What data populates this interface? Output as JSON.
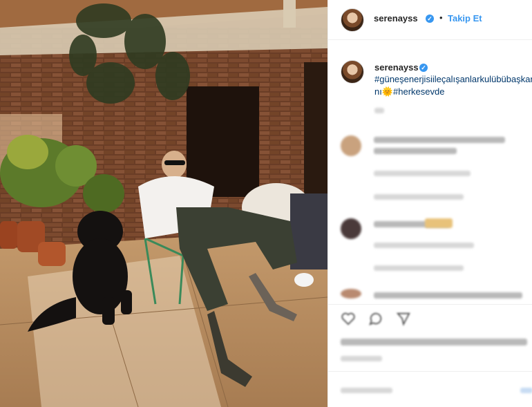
{
  "header": {
    "username": "serenayss",
    "verified_glyph": "✓",
    "separator": "•",
    "follow_label": "Takip Et"
  },
  "caption": {
    "username": "serenayss",
    "line1": "#güneşenerjisiileçalışanlarkulübübaşkanı",
    "line2_prefix": "nı",
    "emoji": "🌞",
    "line2_tag": "#herkesevde"
  },
  "icons": {
    "avatar": "avatar-icon",
    "verified": "verified-badge-icon",
    "like": "heart-icon",
    "comment": "comment-icon",
    "share": "share-icon"
  },
  "colors": {
    "accent": "#3897f0",
    "hashtag": "#00376b",
    "text": "#262626"
  }
}
